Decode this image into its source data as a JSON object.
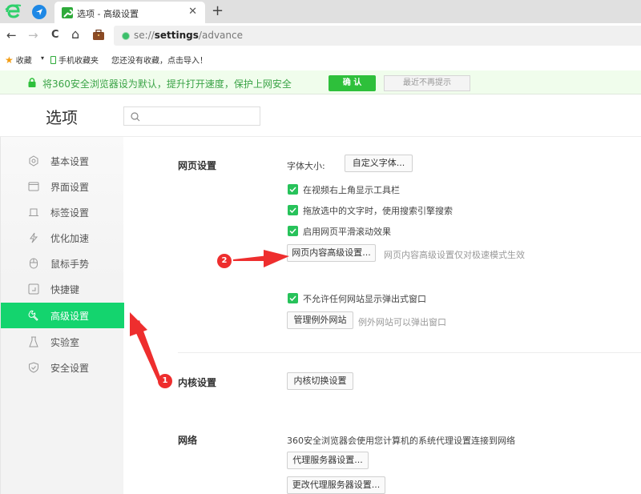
{
  "browser": {
    "tabs": [
      {
        "title": "选项 - 高级设置",
        "active": true
      }
    ],
    "new_tab_symbol": "+",
    "close_symbol": "✕",
    "nav": {
      "back": "←",
      "forward": "→",
      "reload": "C",
      "home": "⌂"
    },
    "url": {
      "scheme": "se://",
      "host": "settings",
      "sep": "/",
      "path": "advance"
    },
    "bookmarks": {
      "favorites_label": "收藏",
      "dropdown": "▾",
      "mobile_label": "手机收藏夹",
      "empty_hint": "您还没有收藏，点击导入！"
    }
  },
  "notice": {
    "text": "将360安全浏览器设为默认，提升打开速度，保护上网安全",
    "confirm_label": "确 认",
    "dismiss_label": "最近不再提示",
    "accent": "#2ec03b"
  },
  "header": {
    "title": "选项",
    "search_placeholder": ""
  },
  "sidebar": {
    "active_color": "#14d46e",
    "items": [
      {
        "label": "基本设置",
        "icon": "gear-icon",
        "active": false
      },
      {
        "label": "界面设置",
        "icon": "window-icon",
        "active": false
      },
      {
        "label": "标签设置",
        "icon": "tab-icon",
        "active": false
      },
      {
        "label": "优化加速",
        "icon": "lightning-icon",
        "active": false
      },
      {
        "label": "鼠标手势",
        "icon": "mouse-icon",
        "active": false
      },
      {
        "label": "快捷键",
        "icon": "keyboard-icon",
        "active": false
      },
      {
        "label": "高级设置",
        "icon": "wrench-icon",
        "active": true
      },
      {
        "label": "实验室",
        "icon": "flask-icon",
        "active": false
      },
      {
        "label": "安全设置",
        "icon": "shield-icon",
        "active": false
      }
    ]
  },
  "content": {
    "webpage": {
      "title": "网页设置",
      "font_size_label": "字体大小:",
      "custom_font_button": "自定义字体...",
      "checkboxes": [
        {
          "label": "在视频右上角显示工具栏",
          "checked": true
        },
        {
          "label": "拖放选中的文字时，使用搜索引擎搜索",
          "checked": true
        },
        {
          "label": "启用网页平滑滚动效果",
          "checked": true
        }
      ],
      "advanced_content_button": "网页内容高级设置...",
      "advanced_content_hint": "网页内容高级设置仅对极速模式生效",
      "popup_checkbox": {
        "label": "不允许任何网站显示弹出式窗口",
        "checked": true
      },
      "manage_exceptions_button": "管理例外网站",
      "manage_exceptions_hint": "例外网站可以弹出窗口"
    },
    "kernel": {
      "title": "内核设置",
      "switch_button": "内核切换设置"
    },
    "network": {
      "title": "网络",
      "description": "360安全浏览器会使用您计算机的系统代理设置连接到网络",
      "proxy_button": "代理服务器设置...",
      "change_proxy_button": "更改代理服务器设置..."
    }
  },
  "annotations": {
    "badge1": "1",
    "badge2": "2",
    "color": "#ee2e2e"
  }
}
